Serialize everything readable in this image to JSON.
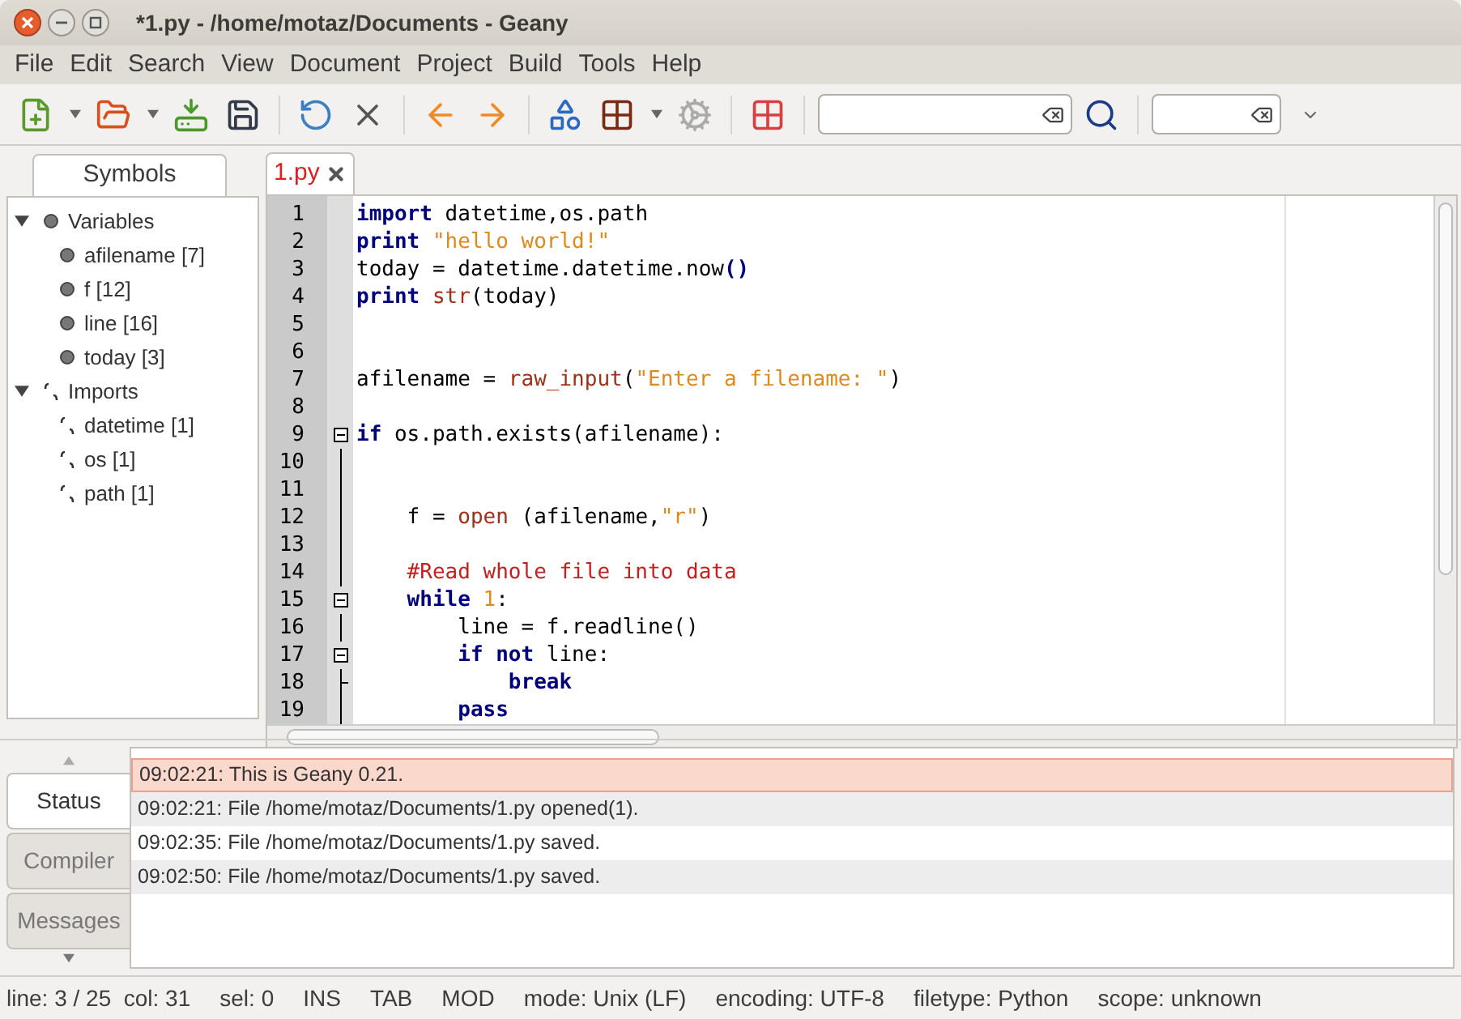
{
  "window": {
    "title": "*1.py - /home/motaz/Documents - Geany"
  },
  "menu": [
    "File",
    "Edit",
    "Search",
    "View",
    "Document",
    "Project",
    "Build",
    "Tools",
    "Help"
  ],
  "sidebar": {
    "tabs": [
      {
        "label": "Symbols",
        "selected": true
      }
    ],
    "tree": [
      {
        "label": "Variables",
        "kind": "variable",
        "expanded": true,
        "children": [
          {
            "label": "afilename [7]",
            "kind": "variable"
          },
          {
            "label": "f [12]",
            "kind": "variable"
          },
          {
            "label": "line [16]",
            "kind": "variable"
          },
          {
            "label": "today [3]",
            "kind": "variable"
          }
        ]
      },
      {
        "label": "Imports",
        "kind": "import",
        "expanded": true,
        "children": [
          {
            "label": "datetime [1]",
            "kind": "import"
          },
          {
            "label": "os [1]",
            "kind": "import"
          },
          {
            "label": "path [1]",
            "kind": "import"
          }
        ]
      }
    ]
  },
  "editor": {
    "tabs": [
      {
        "label": "1.py",
        "selected": true,
        "modified": true
      }
    ],
    "lines": [
      {
        "number": "1",
        "kind": "plain",
        "tokens": [
          {
            "kind": "keyword",
            "text": "import"
          },
          {
            "kind": "plain",
            "text": " datetime,os.path"
          }
        ]
      },
      {
        "number": "2",
        "kind": "plain",
        "tokens": [
          {
            "kind": "keyword",
            "text": "print"
          },
          {
            "kind": "string",
            "text": " \"hello world!\""
          }
        ]
      },
      {
        "number": "3",
        "kind": "plain",
        "tokens": [
          {
            "kind": "plain",
            "text": "today = datetime.datetime.now"
          },
          {
            "kind": "keyword",
            "text": "()"
          }
        ]
      },
      {
        "number": "4",
        "kind": "plain",
        "tokens": [
          {
            "kind": "keyword",
            "text": "print"
          },
          {
            "kind": "builtin",
            "text": " str"
          },
          {
            "kind": "plain",
            "text": "(today)"
          }
        ]
      },
      {
        "number": "5",
        "kind": "plain"
      },
      {
        "number": "6",
        "kind": "plain"
      },
      {
        "number": "7",
        "kind": "plain",
        "tokens": [
          {
            "kind": "plain",
            "text": "afilename = "
          },
          {
            "kind": "builtin",
            "text": "raw_input"
          },
          {
            "kind": "plain",
            "text": "("
          },
          {
            "kind": "string",
            "text": "\"Enter a filename: \""
          },
          {
            "kind": "plain",
            "text": ")"
          }
        ]
      },
      {
        "number": "8",
        "kind": "plain"
      },
      {
        "number": "9",
        "kind": "fold_start",
        "tokens": [
          {
            "kind": "keyword",
            "text": "if"
          },
          {
            "kind": "plain",
            "text": " os.path.exists(afilename):"
          }
        ]
      },
      {
        "number": "10",
        "kind": "fold_body"
      },
      {
        "number": "11",
        "kind": "fold_body"
      },
      {
        "number": "12",
        "kind": "fold_body",
        "tokens": [
          {
            "kind": "plain",
            "text": "    f = "
          },
          {
            "kind": "builtin",
            "text": "open"
          },
          {
            "kind": "plain",
            "text": " (afilename,"
          },
          {
            "kind": "string",
            "text": "\"r\""
          },
          {
            "kind": "plain",
            "text": ")"
          }
        ]
      },
      {
        "number": "13",
        "kind": "fold_body"
      },
      {
        "number": "14",
        "kind": "fold_body",
        "tokens": [
          {
            "kind": "comment",
            "text": "    #Read whole file into data"
          }
        ]
      },
      {
        "number": "15",
        "kind": "fold_start",
        "tokens": [
          {
            "kind": "keyword",
            "text": "    while"
          },
          {
            "kind": "number",
            "text": " 1"
          },
          {
            "kind": "plain",
            "text": ":"
          }
        ]
      },
      {
        "number": "16",
        "kind": "fold_body",
        "tokens": [
          {
            "kind": "plain",
            "text": "        line = f.readline()"
          }
        ]
      },
      {
        "number": "17",
        "kind": "fold_start",
        "tokens": [
          {
            "kind": "keyword",
            "text": "        if not"
          },
          {
            "kind": "plain",
            "text": " line:"
          }
        ]
      },
      {
        "number": "18",
        "kind": "fold_end",
        "tokens": [
          {
            "kind": "keyword",
            "text": "            break"
          }
        ]
      },
      {
        "number": "19",
        "kind": "fold_body",
        "tokens": [
          {
            "kind": "keyword",
            "text": "        pass"
          }
        ]
      }
    ]
  },
  "messages": {
    "tabs": [
      {
        "label": "Status",
        "selected": true
      },
      {
        "label": "Compiler",
        "selected": false
      },
      {
        "label": "Messages",
        "selected": false
      }
    ],
    "entries": [
      {
        "text": "09:02:21: This is Geany 0.21.",
        "selected": true
      },
      {
        "text": "09:02:21: File /home/motaz/Documents/1.py opened(1).",
        "selected": false
      },
      {
        "text": "09:02:35: File /home/motaz/Documents/1.py saved.",
        "selected": false
      },
      {
        "text": "09:02:50: File /home/motaz/Documents/1.py saved.",
        "selected": false
      }
    ]
  },
  "status_bar": [
    "line: 3 / 25  col: 31",
    "sel: 0",
    "INS",
    "TAB",
    "MOD",
    "mode: Unix (LF)",
    "encoding: UTF-8",
    "filetype: Python",
    "scope: unknown"
  ]
}
